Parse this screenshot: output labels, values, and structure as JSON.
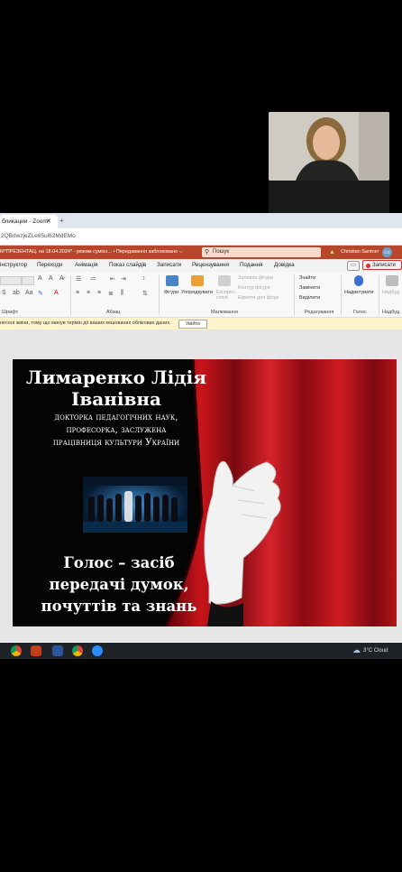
{
  "browser": {
    "tab_label": "бликации - Zoom",
    "tab_close": "✕",
    "new_tab": "+",
    "url": "2QBdwzjeZLe65ul62MdEMo"
  },
  "ppt": {
    "doc_title": "М*ПРЕЗЕНТАЦ. на 18.04.2024* - режим сумісн... • Передавання заблоковано ⌵",
    "search_placeholder": "Пошук",
    "user_name": "Christian Santner",
    "user_initials": "CS",
    "menu": [
      "інструктор",
      "Переходи",
      "Анімація",
      "Показ слайдів",
      "Записати",
      "Рецензування",
      "Подання",
      "Довідка"
    ],
    "comment_btn": "▭",
    "record_btn": "Записати",
    "groups": [
      "Шрифт",
      "Абзац",
      "Малювання",
      "Редагування",
      "Голос",
      "Надбуд"
    ],
    "buttons": {
      "shapes": "Фігури",
      "arrange": "Упорядкувати",
      "quick_styles": "Експрес-стилі",
      "shape_fill": "Заливка фігури",
      "shape_outline": "Контур фігури",
      "shape_effects": "Ефекти для фігур",
      "find": "Знайти",
      "replace": "Замінити",
      "select": "Виділити",
      "dictate": "Надиктувати",
      "addins": "Надбуд"
    },
    "info_text": "несені зміни, тому що минув термін дії ваших кешованих облікових даних.",
    "refresh_btn": "Увійти"
  },
  "slide": {
    "name_line1": "Лимаренко Лідія",
    "name_line2": "Іванівна",
    "desc_line1": "докторка педагогічних наук,",
    "desc_line2": "професорка, заслужена",
    "desc_line3": "працівниця культури України",
    "quote_line1": "Голос – засіб",
    "quote_line2": "передачі думок,",
    "quote_line3": "почуттів та знань"
  },
  "taskbar": {
    "weather": "3°C Cloud"
  },
  "colors": {
    "ppt_accent": "#b7472a",
    "curtain_red": "#c8151b",
    "info_bar": "#fff4ce"
  }
}
